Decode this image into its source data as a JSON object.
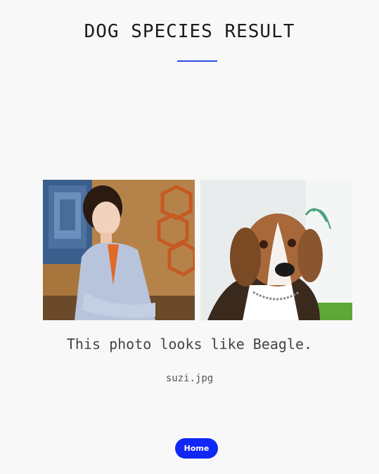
{
  "page": {
    "title": "DOG SPECIES RESULT",
    "accent_color": "#2a4de0"
  },
  "images": {
    "uploaded_photo": {
      "description_icon": "person-photo"
    },
    "matched_breed_photo": {
      "description_icon": "beagle-photo"
    }
  },
  "result": {
    "message": "This photo looks like Beagle.",
    "filename": "suzi.jpg"
  },
  "actions": {
    "home_label": "Home",
    "home_color": "#1027f5"
  }
}
